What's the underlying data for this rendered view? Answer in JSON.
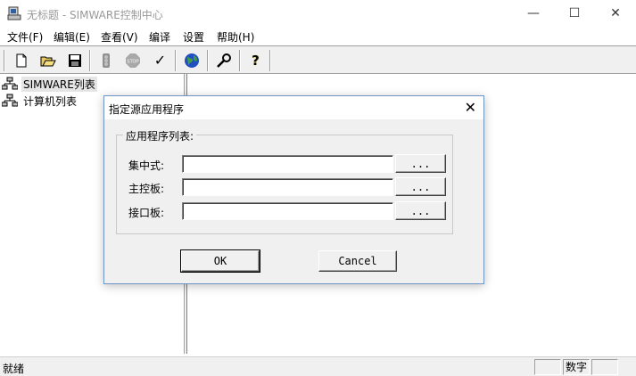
{
  "window": {
    "title": "无标题 - SIMWARE控制中心",
    "minimize": "—",
    "maximize": "☐",
    "close": "✕"
  },
  "menu": [
    {
      "label": "文件(F)"
    },
    {
      "label": "编辑(E)"
    },
    {
      "label": "查看(V)"
    },
    {
      "label": "编译"
    },
    {
      "label": "设置"
    },
    {
      "label": "帮助(H)"
    }
  ],
  "toolbar": {
    "buttons": [
      {
        "icon": "new-file-icon"
      },
      {
        "icon": "open-folder-icon"
      },
      {
        "icon": "save-icon"
      },
      {
        "icon": "traffic-light-icon"
      },
      {
        "icon": "stop-icon",
        "text": "STOP"
      },
      {
        "icon": "check-icon",
        "text": "✓"
      },
      {
        "icon": "globe-icon"
      },
      {
        "icon": "wrench-icon"
      },
      {
        "icon": "help-icon",
        "text": "?"
      }
    ]
  },
  "tree": {
    "items": [
      {
        "label": "SIMWARE列表",
        "selected": true
      },
      {
        "label": "计算机列表",
        "selected": false
      }
    ]
  },
  "dialog": {
    "title": "指定源应用程序",
    "close": "✕",
    "group_label": "应用程序列表:",
    "fields": [
      {
        "label": "集中式:",
        "value": "",
        "browse": "..."
      },
      {
        "label": "主控板:",
        "value": "",
        "browse": "..."
      },
      {
        "label": "接口板:",
        "value": "",
        "browse": "..."
      }
    ],
    "ok_label": "OK",
    "cancel_label": "Cancel"
  },
  "status": {
    "main": "就绪",
    "pane1": "",
    "pane2": "数字",
    "pane3": ""
  }
}
